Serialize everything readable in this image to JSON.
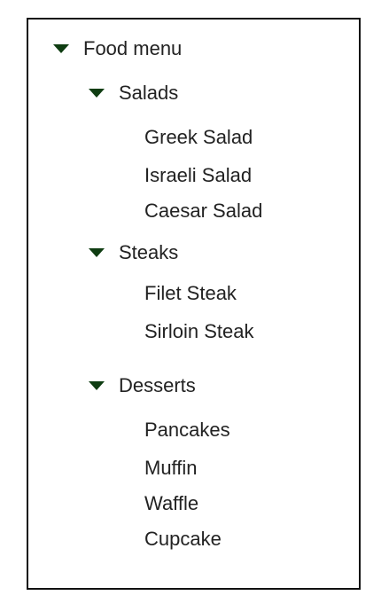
{
  "tree": {
    "root": {
      "label": "Food menu",
      "expanded": true,
      "toggle_icon": "triangle-down-icon",
      "categories": [
        {
          "label": "Salads",
          "expanded": true,
          "toggle_icon": "triangle-down-icon",
          "items": [
            "Greek Salad",
            "Israeli Salad",
            "Caesar Salad"
          ]
        },
        {
          "label": "Steaks",
          "expanded": true,
          "toggle_icon": "triangle-down-icon",
          "items": [
            "Filet Steak",
            "Sirloin Steak"
          ]
        },
        {
          "label": "Desserts",
          "expanded": true,
          "toggle_icon": "triangle-down-icon",
          "items": [
            "Pancakes",
            "Muffin",
            "Waffle",
            "Cupcake"
          ]
        }
      ]
    }
  },
  "colors": {
    "toggle_arrow": "#0f3d12",
    "text": "#222222",
    "border": "#111111"
  }
}
